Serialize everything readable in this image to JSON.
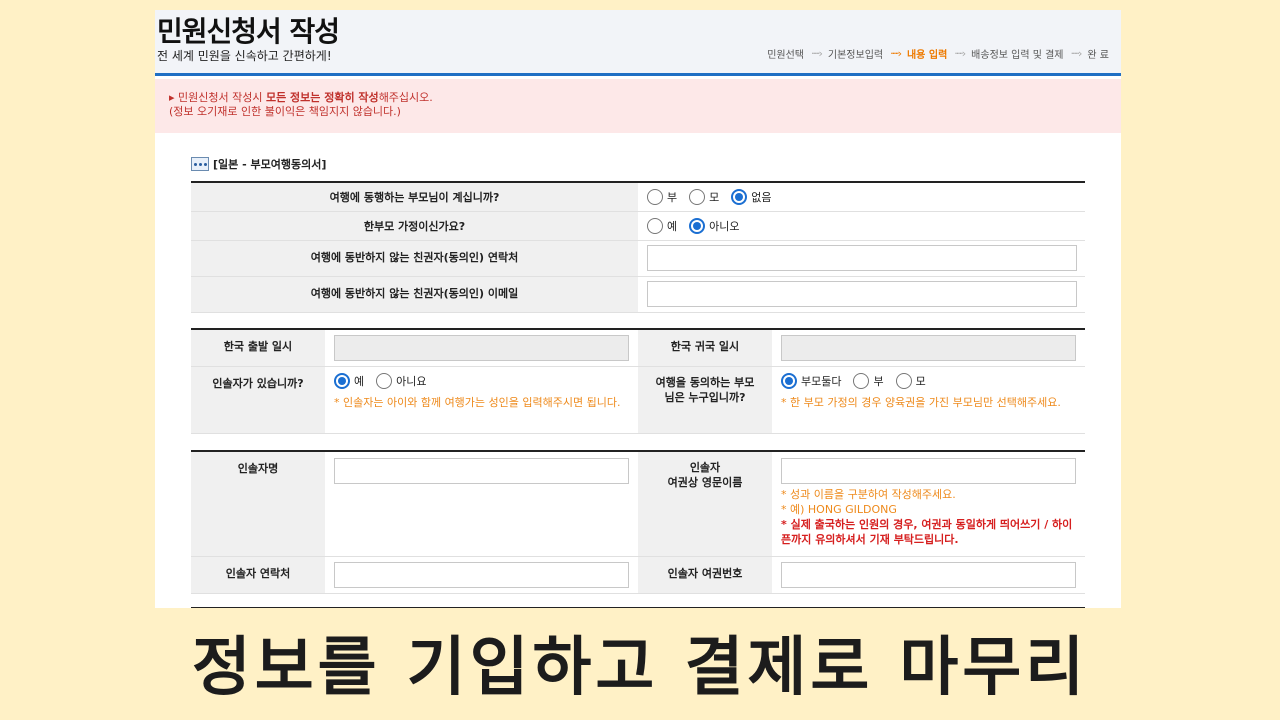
{
  "header": {
    "title": "민원신청서 작성",
    "subtitle": "전 세계 민원을 신속하고 간편하게!",
    "steps": [
      "민원선택",
      "기본정보입력",
      "내용 입력",
      "배송정보 입력 및 결제",
      "완 료"
    ],
    "active_step": "내용 입력"
  },
  "notice": {
    "line1_pre": "민원신청서 작성시 ",
    "line1_bold": "모든 정보는 정확히 작성",
    "line1_post": "해주십시오.",
    "line2": "(정보 오기재로 인한 불이익은 책임지지 않습니다.)"
  },
  "form": {
    "title": "[일본 - 부모여행동의서]",
    "q1": {
      "label": "여행에 동행하는 부모님이 계십니까?",
      "options": [
        "부",
        "모",
        "없음"
      ],
      "selected": "없음"
    },
    "q2": {
      "label": "한부모 가정이신가요?",
      "options": [
        "예",
        "아니오"
      ],
      "selected": "아니오"
    },
    "q3": {
      "label": "여행에 동반하지 않는 친권자(동의인) 연락처",
      "value": ""
    },
    "q4": {
      "label": "여행에 동반하지 않는 친권자(동의인) 이메일",
      "value": ""
    },
    "departure": {
      "label": "한국 출발 일시",
      "value": ""
    },
    "return": {
      "label": "한국 귀국 일시",
      "value": ""
    },
    "escort": {
      "label": "인솔자가 있습니까?",
      "options": [
        "예",
        "아니요"
      ],
      "selected": "예",
      "note": "* 인솔자는 아이와 함께 여행가는 성인을 입력해주시면 됩니다."
    },
    "consent": {
      "label": "여행을 동의하는 부모님은 누구입니까?",
      "options": [
        "부모둘다",
        "부",
        "모"
      ],
      "selected": "부모둘다",
      "note": "* 한 부모 가정의 경우 양육권을 가진 부모님만 선택해주세요."
    },
    "escort_name": {
      "label": "인솔자명",
      "value": ""
    },
    "escort_eng": {
      "label_1": "인솔자",
      "label_2": "여권상 영문이름",
      "value": "",
      "note1": "* 성과 이름을 구분하여 작성해주세요.",
      "note2": "* 예) HONG GILDONG",
      "note3": "* 실제 출국하는 인원의 경우, 여권과 동일하게 띄어쓰기 / 하이픈까지 유의하셔서 기재 부탁드립니다."
    },
    "escort_phone": {
      "label": "인솔자 연락처",
      "value": ""
    },
    "escort_passport": {
      "label": "인솔자 여권번호",
      "value": ""
    }
  },
  "caption": "정보를 기입하고 결제로 마무리",
  "colors": {
    "background": "#fff1c6",
    "accent_blue": "#1f6fc4",
    "step_active": "#ee7a00",
    "notice_bg": "#fde8e8",
    "notice_text": "#c0312c",
    "note_orange": "#ee8a1c",
    "note_red": "#d61f1f"
  }
}
